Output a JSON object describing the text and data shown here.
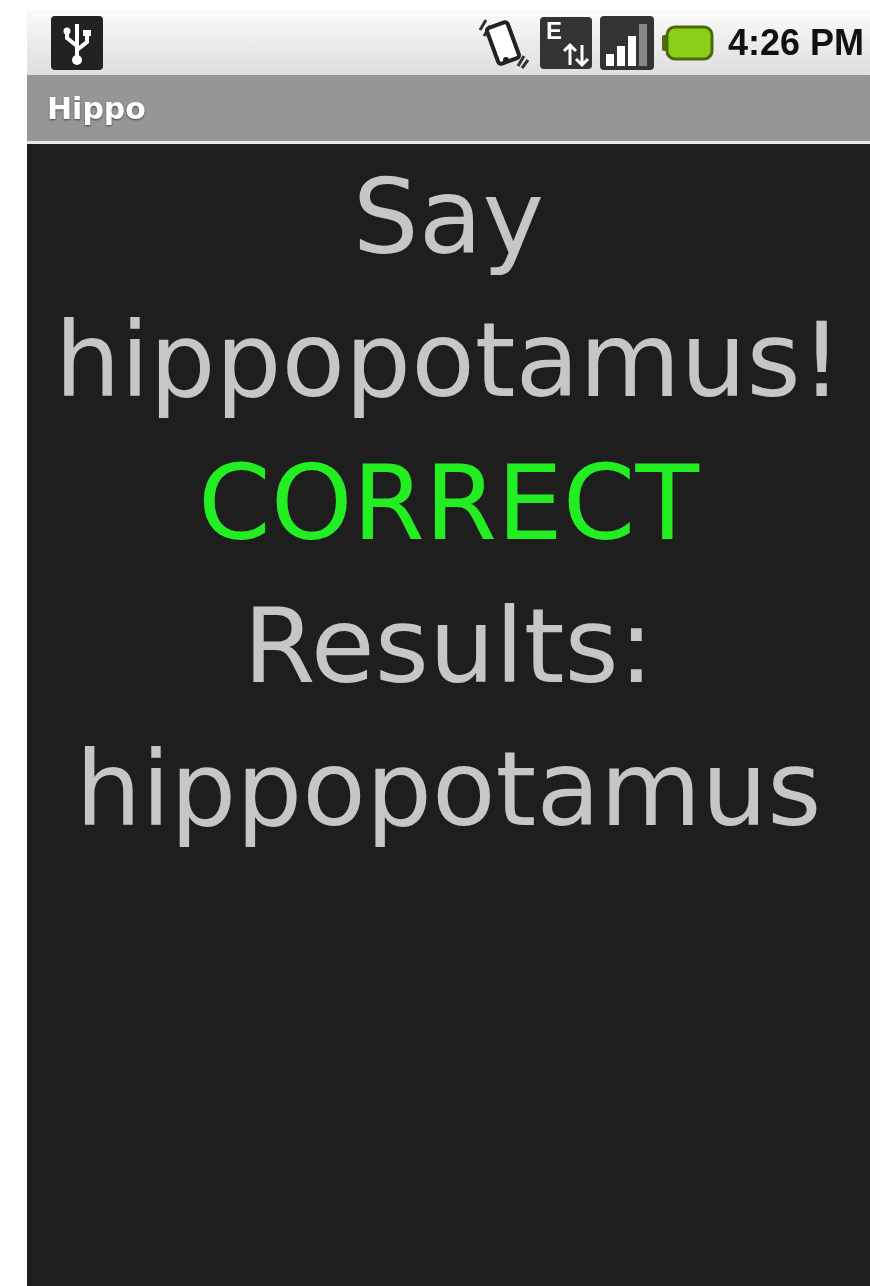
{
  "status_bar": {
    "network_type": "E",
    "time": "4:26 PM"
  },
  "title_bar": {
    "title": "Hippo"
  },
  "content": {
    "prompt": "Say hippopotamus!",
    "result": {
      "label": "CORRECT",
      "correct": true
    },
    "results": "Results: hippopotamus"
  }
}
